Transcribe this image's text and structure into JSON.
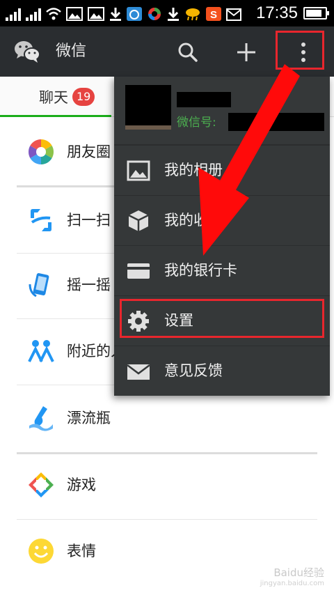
{
  "status_bar": {
    "time": "17:35",
    "icons": [
      "signal-1-icon",
      "signal-2-icon",
      "wifi-icon",
      "image-icon",
      "image-icon",
      "download-icon",
      "cloud-app-icon",
      "circle-app-icon",
      "download-icon",
      "weather-icon",
      "app-s-icon",
      "mail-icon",
      "battery-icon"
    ]
  },
  "action_bar": {
    "title": "微信",
    "icons": [
      "wechat-logo-icon",
      "search-icon",
      "plus-icon",
      "more-vertical-icon"
    ]
  },
  "tabs": [
    {
      "label": "聊天",
      "badge": "19",
      "active": true
    }
  ],
  "list": [
    {
      "label": "朋友圈",
      "icon": "moments-icon"
    },
    {
      "label": "扫一扫",
      "icon": "scan-icon"
    },
    {
      "label": "摇一摇",
      "icon": "shake-icon"
    },
    {
      "label": "附近的人",
      "icon": "people-nearby-icon"
    },
    {
      "label": "漂流瓶",
      "icon": "drift-bottle-icon"
    },
    {
      "label": "游戏",
      "icon": "games-icon"
    },
    {
      "label": "表情",
      "icon": "sticker-icon"
    }
  ],
  "menu": {
    "wechat_id_label": "微信号:",
    "items": [
      {
        "label": "我的相册",
        "icon": "album-icon"
      },
      {
        "label": "我的收藏",
        "icon": "favorites-icon"
      },
      {
        "label": "我的银行卡",
        "icon": "bank-card-icon"
      },
      {
        "label": "设置",
        "icon": "settings-gear-icon"
      },
      {
        "label": "意见反馈",
        "icon": "feedback-mail-icon"
      }
    ]
  },
  "watermark": {
    "text": "Baidu经验",
    "url": "jingyan.baidu.com"
  },
  "colors": {
    "action_bar": "#2a2d30",
    "menu_bg": "#353839",
    "accent_green": "#1aad19",
    "badge_red": "#e64340",
    "annotation_red": "#e8262d"
  }
}
